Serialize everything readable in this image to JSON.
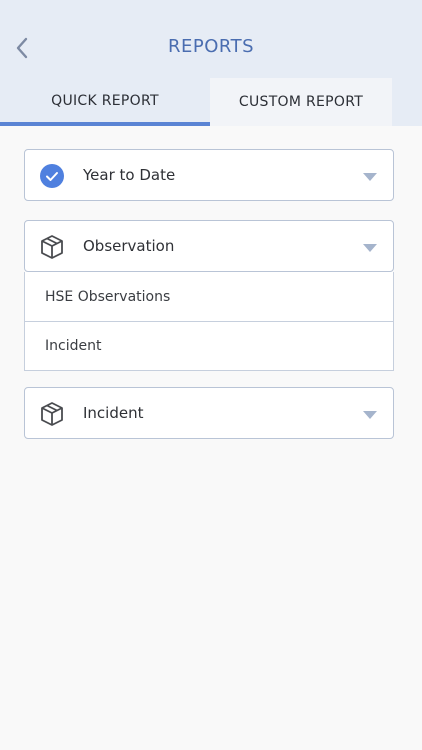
{
  "header": {
    "title": "REPORTS",
    "back_icon": "chevron-left-icon"
  },
  "tabs": [
    {
      "label": "QUICK REPORT",
      "active": true
    },
    {
      "label": "CUSTOM REPORT",
      "active": false
    }
  ],
  "filters": {
    "period": {
      "label": "Year to Date",
      "icon": "check-circle-icon"
    },
    "category": {
      "label": "Observation",
      "icon": "box-icon",
      "expanded": true,
      "options": [
        "HSE Observations",
        "Incident"
      ]
    },
    "type": {
      "label": "Incident",
      "icon": "box-icon"
    }
  },
  "colors": {
    "accent": "#5a84d4",
    "header_bg": "#e6ecf5",
    "title": "#4a6db0",
    "border": "#b9c4d6"
  }
}
